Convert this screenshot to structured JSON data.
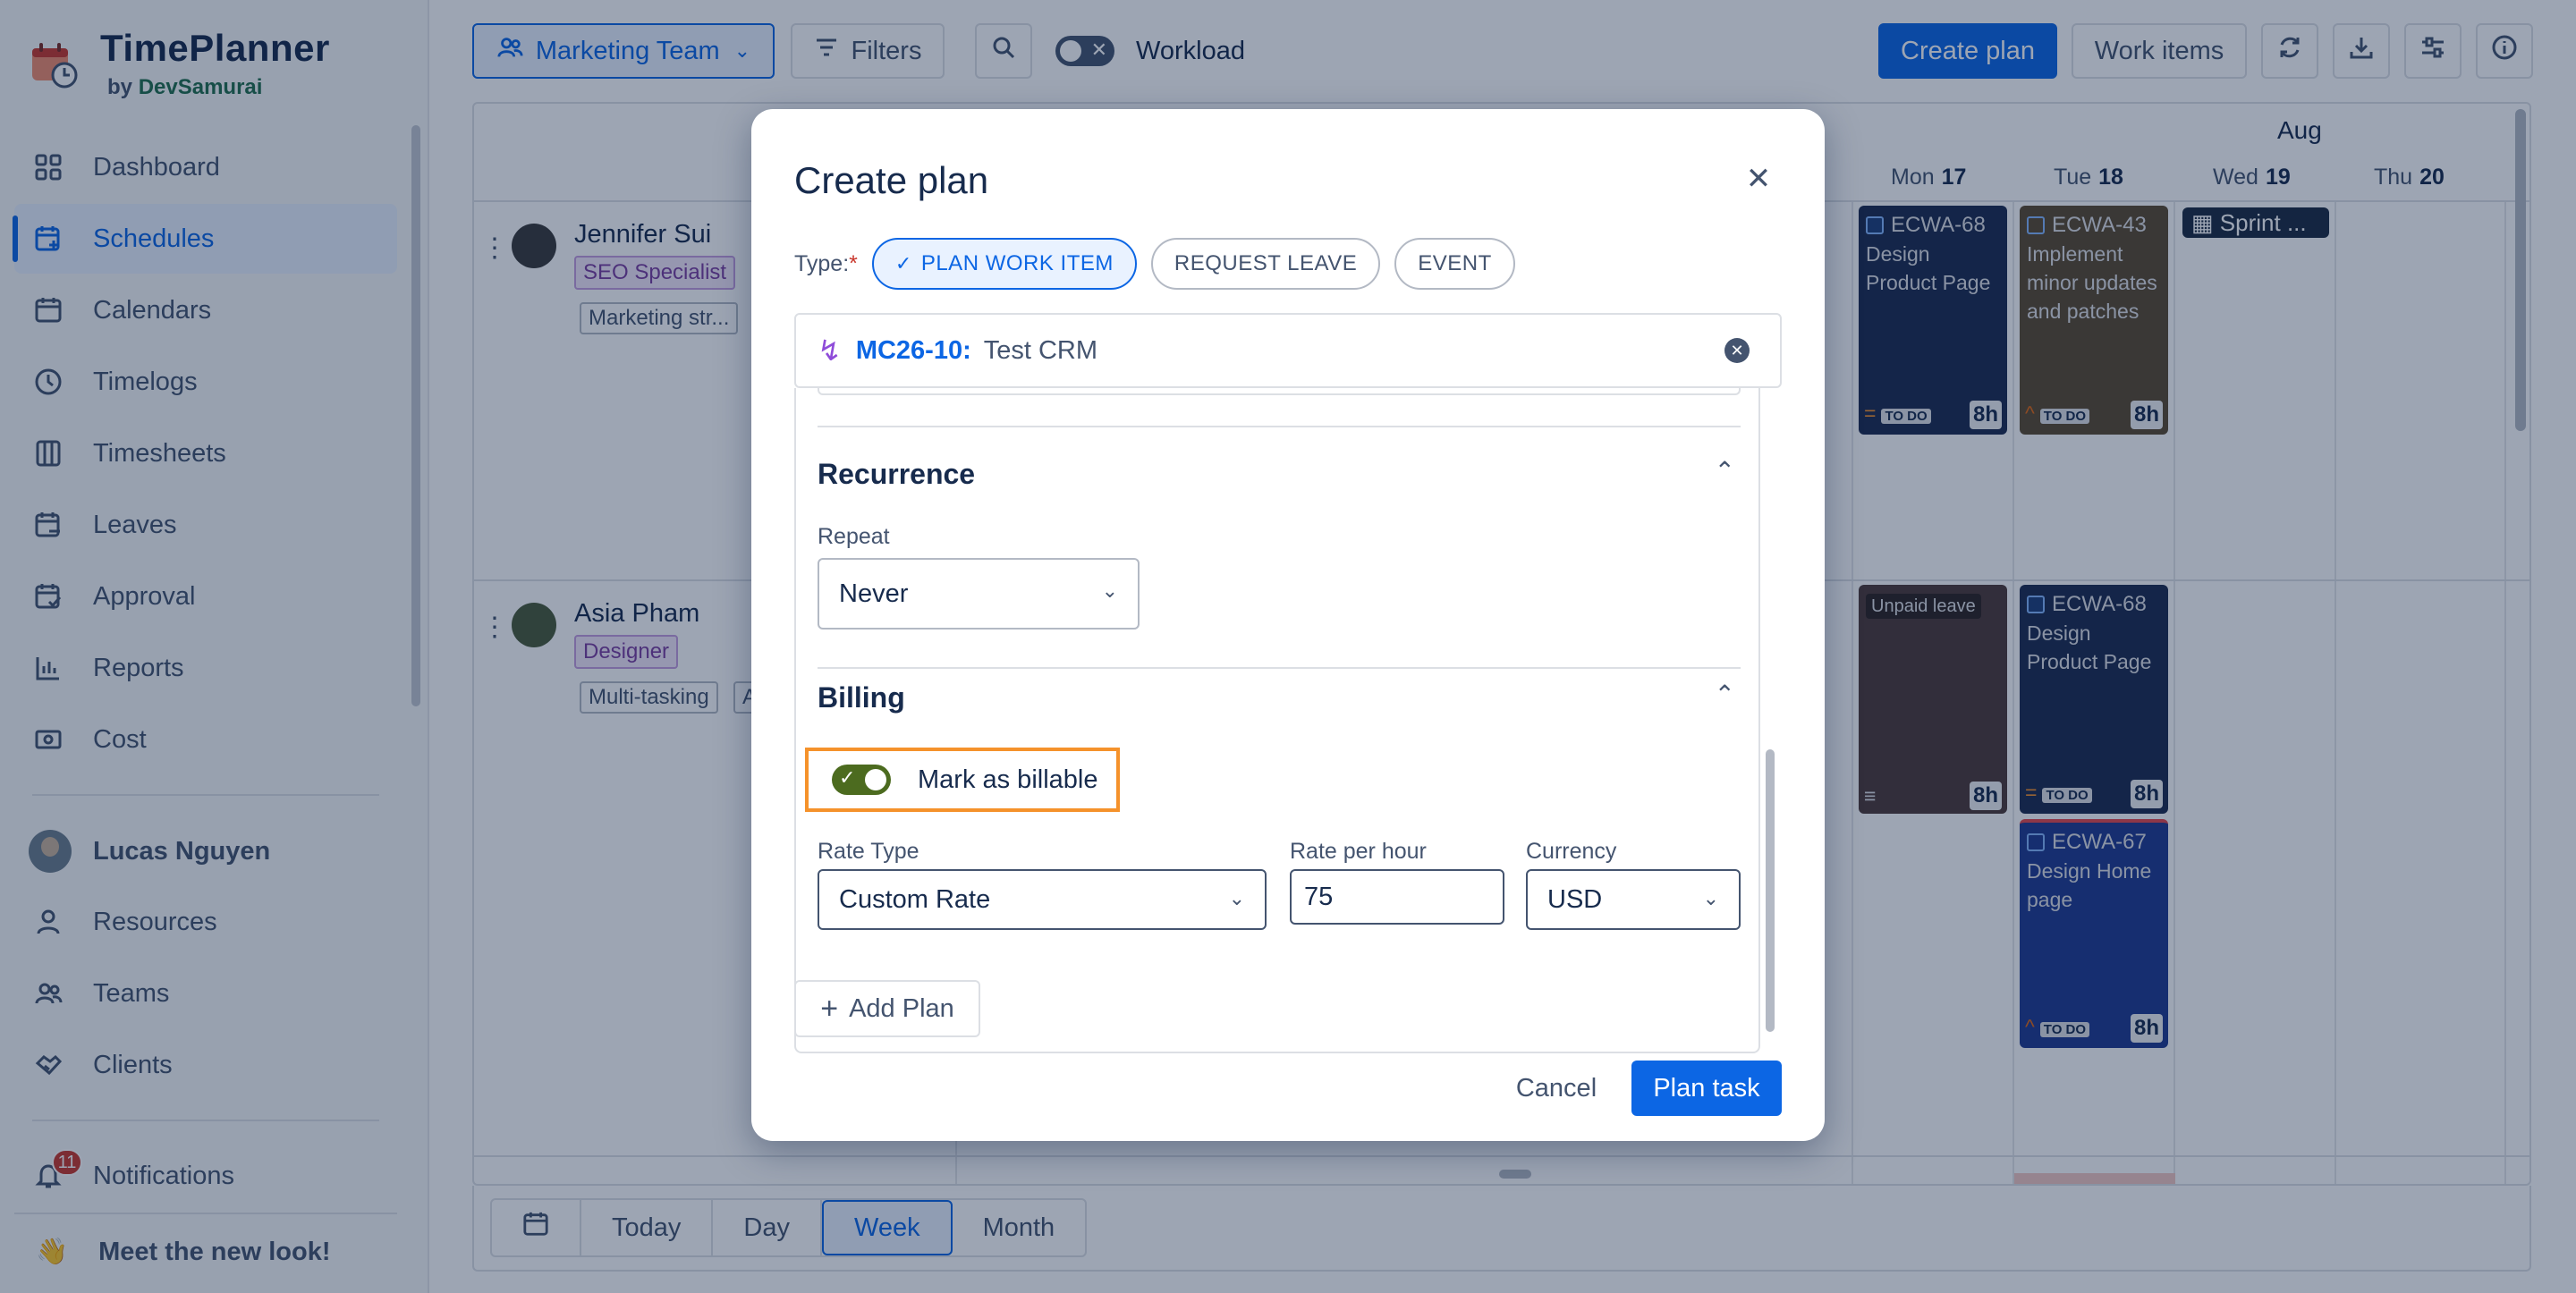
{
  "app": {
    "name": "TimePlanner",
    "by_prefix": "by",
    "by_vendor": "DevSamurai"
  },
  "sidebar": {
    "items": [
      {
        "label": "Dashboard",
        "icon": "grid-icon"
      },
      {
        "label": "Schedules",
        "icon": "calendar-plus-icon",
        "active": true
      },
      {
        "label": "Calendars",
        "icon": "calendar-icon"
      },
      {
        "label": "Timelogs",
        "icon": "clock-icon"
      },
      {
        "label": "Timesheets",
        "icon": "columns-icon"
      },
      {
        "label": "Leaves",
        "icon": "calendar-minus-icon"
      },
      {
        "label": "Approval",
        "icon": "calendar-check-icon"
      },
      {
        "label": "Reports",
        "icon": "bar-chart-icon"
      },
      {
        "label": "Cost",
        "icon": "money-icon"
      }
    ],
    "user": "Lucas Nguyen",
    "manage_items": [
      {
        "label": "Resources",
        "icon": "person-icon"
      },
      {
        "label": "Teams",
        "icon": "people-icon"
      },
      {
        "label": "Clients",
        "icon": "handshake-icon"
      }
    ],
    "notifications": {
      "label": "Notifications",
      "count": "11"
    },
    "meet": {
      "emoji": "👋",
      "label": "Meet the new look!"
    }
  },
  "toolbar": {
    "team": "Marketing Team",
    "filters": "Filters",
    "workload": "Workload",
    "create_plan": "Create plan",
    "work_items": "Work items"
  },
  "calendar": {
    "month": "Aug",
    "days": [
      {
        "dow": "Mon",
        "num": "17"
      },
      {
        "dow": "Tue",
        "num": "18"
      },
      {
        "dow": "Wed",
        "num": "19"
      },
      {
        "dow": "Thu",
        "num": "20"
      }
    ],
    "people": [
      {
        "name": "Jennifer Sui",
        "role": "SEO Specialist",
        "tag": "Marketing str..."
      },
      {
        "name": "Asia Pham",
        "role": "Designer",
        "tag": "Multi-tasking",
        "tag2": "A"
      }
    ],
    "tasks": [
      {
        "code": "ECWA-68",
        "title": "Design Product Page",
        "status": "TO DO",
        "hours": "8h"
      },
      {
        "code": "ECWA-43",
        "title": "Implement minor updates and patches",
        "status": "TO DO",
        "hours": "8h"
      },
      {
        "label": "Unpaid leave",
        "hours": "8h"
      },
      {
        "code": "ECWA-68",
        "title": "Design Product Page",
        "status": "TO DO",
        "hours": "8h"
      },
      {
        "code": "ECWA-67",
        "title": "Design Home page",
        "status": "TO DO",
        "hours": "8h"
      }
    ],
    "sprint": "Sprint ...",
    "views": [
      "Today",
      "Day",
      "Week",
      "Month"
    ],
    "active_view": "Week"
  },
  "modal": {
    "title": "Create plan",
    "type_label": "Type:",
    "type_required": "*",
    "types": [
      "PLAN WORK ITEM",
      "REQUEST LEAVE",
      "EVENT"
    ],
    "active_type": "PLAN WORK ITEM",
    "work_item": {
      "key": "MC26-10:",
      "name": "Test CRM"
    },
    "recurrence": {
      "title": "Recurrence",
      "repeat_label": "Repeat",
      "repeat_value": "Never"
    },
    "billing": {
      "title": "Billing",
      "billable_label": "Mark as billable",
      "billable": true,
      "rate_type_label": "Rate Type",
      "rate_type": "Custom Rate",
      "rate_label": "Rate per hour",
      "rate": "75",
      "currency_label": "Currency",
      "currency": "USD"
    },
    "add_plan": "Add Plan",
    "cancel": "Cancel",
    "submit": "Plan task"
  },
  "colors": {
    "primary": "#0c66e4",
    "highlight": "#f5922b",
    "toggle_on": "#4c6b1f",
    "task_navy": "#1c2b4f",
    "task_olive": "#5b4a2f",
    "task_leave": "#4e3a37",
    "task_blue": "#1f3a8f"
  }
}
